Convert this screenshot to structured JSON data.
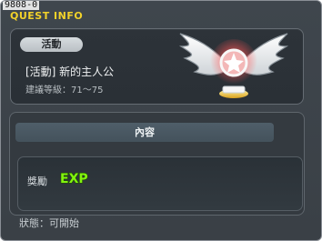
{
  "window": {
    "id_text": "9808-0",
    "title": "QUEST INFO"
  },
  "quest": {
    "category": "活動",
    "name": "[活動] 新的主人公",
    "recommended_level": "建議等級：71～75"
  },
  "content": {
    "header": "內容",
    "reward_label": "獎勵",
    "reward_icon": "exp-icon",
    "reward_icon_text": "EXP"
  },
  "status": "狀態：可開始",
  "colors": {
    "title": "#f2d22a",
    "background": "#3f464d",
    "exp": "#82f30f"
  }
}
